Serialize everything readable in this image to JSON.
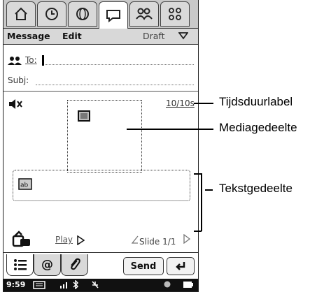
{
  "menu": {
    "message": "Message",
    "edit": "Edit",
    "draft": "Draft"
  },
  "compose": {
    "to_label": "To:",
    "subj_label": "Subj:",
    "duration": "10/10s",
    "play_label": "Play",
    "slide": "Slide 1/1"
  },
  "toolbar": {
    "send": "Send"
  },
  "status": {
    "time": "9:59"
  },
  "callouts": {
    "duration_label": "Tijdsduurlabel",
    "media_area": "Mediagedeelte",
    "text_area": "Tekstgedeelte"
  },
  "icons": {
    "top_tabs": [
      "home-icon",
      "clock-icon",
      "globe-icon",
      "message-icon",
      "contacts-icon",
      "apps-icon"
    ],
    "bottom_tabs": [
      "list-icon",
      "at-icon",
      "attach-icon"
    ]
  }
}
